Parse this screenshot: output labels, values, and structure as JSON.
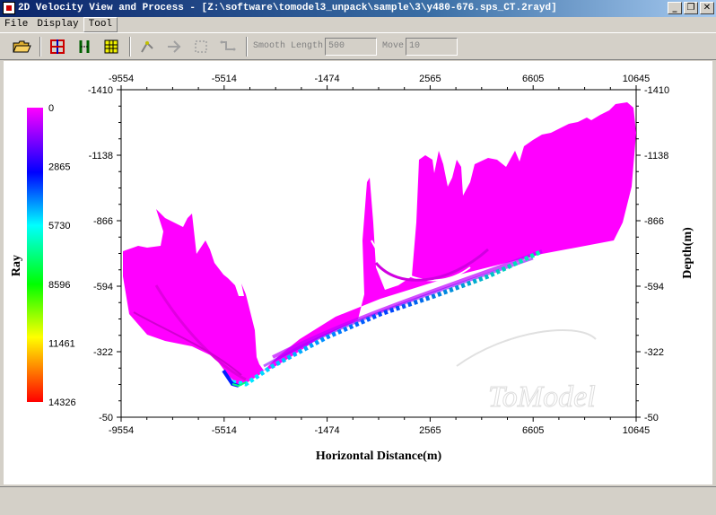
{
  "window": {
    "title": "2D Velocity View and Process - [Z:\\software\\tomodel3_unpack\\sample\\3\\y480-676.sps_CT.2rayd]",
    "buttons": [
      "_",
      "❐",
      "✕"
    ]
  },
  "menu": [
    {
      "label": "File"
    },
    {
      "label": "Display"
    },
    {
      "label": "Tool"
    }
  ],
  "toolbar": {
    "icons": [
      "open-folder-icon",
      "crosshair-icon",
      "bracket-icon",
      "grid-icon",
      "tool-a-icon",
      "tool-b-icon",
      "tool-c-icon",
      "tool-d-icon"
    ],
    "smooth_label": "Smooth Length",
    "smooth_value": "500",
    "move_label": "Move",
    "move_value": "10"
  },
  "plot": {
    "xlabel": "Horizontal Distance(m)",
    "ylabel": "Depth(m)",
    "x_ticks": [
      "-9554",
      "-5514",
      "-1474",
      "2565",
      "6605",
      "10645"
    ],
    "y_ticks": [
      "-1410",
      "-1138",
      "-866",
      "-594",
      "-322",
      "-50"
    ],
    "watermark": "ToModel"
  },
  "colorbar": {
    "label": "Ray",
    "ticks": [
      "0",
      "2865",
      "5730",
      "8596",
      "11461",
      "14326"
    ]
  },
  "chart_data": {
    "type": "heatmap",
    "xlabel": "Horizontal Distance(m)",
    "ylabel": "Depth(m)",
    "xlim": [
      -9554,
      10645
    ],
    "ylim": [
      -1410,
      -50
    ],
    "colorbar_label": "Ray",
    "colorbar_range": [
      0,
      14326
    ],
    "colors": {
      "low": "#ff00ff",
      "mid": "#00ffff",
      "high": "#ff0000"
    }
  }
}
